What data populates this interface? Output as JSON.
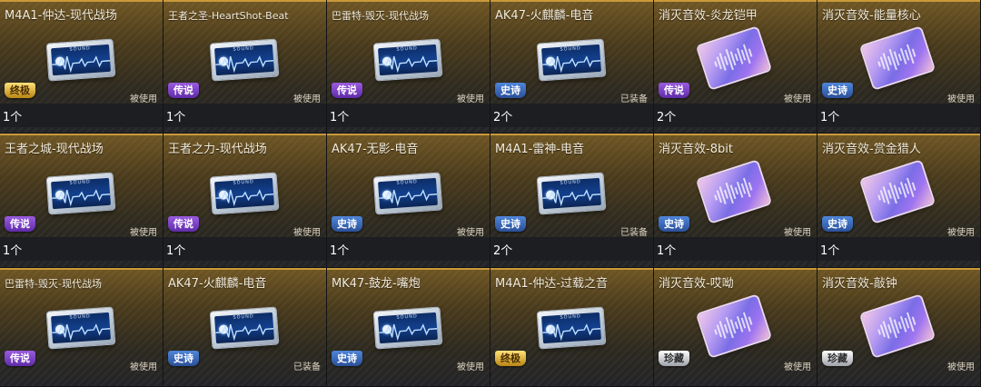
{
  "colors": {
    "card_top": "#6e5523",
    "card_bottom": "#232427",
    "card_border": "#c99a3a",
    "legendary": "#7a3fc8",
    "epic": "#3d6cc0",
    "ultimate": "#e0b030",
    "treasure": "#d9d9d9"
  },
  "items": [
    {
      "title": "M4A1-仲达-现代战场",
      "small": false,
      "type": "silver",
      "badge": "终极",
      "badge_color": "gold",
      "status": "被使用",
      "qty": "1个"
    },
    {
      "title": "王者之圣-HeartShot-Beat",
      "small": true,
      "type": "silver",
      "badge": "传说",
      "badge_color": "purple",
      "status": "被使用",
      "qty": "1个"
    },
    {
      "title": "巴雷特-毁灭-现代战场",
      "small": true,
      "type": "silver",
      "badge": "传说",
      "badge_color": "purple",
      "status": "被使用",
      "qty": "1个"
    },
    {
      "title": "AK47-火麒麟-电音",
      "small": false,
      "type": "silver",
      "badge": "史诗",
      "badge_color": "blue",
      "status": "已装备",
      "qty": "2个"
    },
    {
      "title": "消灭音效-炎龙铠甲",
      "small": false,
      "type": "holo",
      "badge": "传说",
      "badge_color": "purple",
      "status": "被使用",
      "qty": "2个"
    },
    {
      "title": "消灭音效-能量核心",
      "small": false,
      "type": "holo",
      "badge": "史诗",
      "badge_color": "blue",
      "status": "被使用",
      "qty": "1个"
    },
    {
      "title": "王者之城-现代战场",
      "small": false,
      "type": "silver",
      "badge": "传说",
      "badge_color": "purple",
      "status": "被使用",
      "qty": "1个"
    },
    {
      "title": "王者之力-现代战场",
      "small": false,
      "type": "silver",
      "badge": "传说",
      "badge_color": "purple",
      "status": "被使用",
      "qty": "1个"
    },
    {
      "title": "AK47-无影-电音",
      "small": false,
      "type": "silver",
      "badge": "史诗",
      "badge_color": "blue",
      "status": "被使用",
      "qty": "1个"
    },
    {
      "title": "M4A1-雷神-电音",
      "small": false,
      "type": "silver",
      "badge": "史诗",
      "badge_color": "blue",
      "status": "已装备",
      "qty": "2个"
    },
    {
      "title": "消灭音效-8bit",
      "small": false,
      "type": "holo",
      "badge": "史诗",
      "badge_color": "blue",
      "status": "被使用",
      "qty": "1个"
    },
    {
      "title": "消灭音效-赏金猎人",
      "small": false,
      "type": "holo",
      "badge": "史诗",
      "badge_color": "blue",
      "status": "被使用",
      "qty": "1个"
    },
    {
      "title": "巴雷特-毁灭-现代战场",
      "small": true,
      "type": "silver",
      "badge": "传说",
      "badge_color": "purple",
      "status": "被使用",
      "qty": ""
    },
    {
      "title": "AK47-火麒麟-电音",
      "small": false,
      "type": "silver",
      "badge": "史诗",
      "badge_color": "blue",
      "status": "已装备",
      "qty": ""
    },
    {
      "title": "MK47-鼓龙-嘴炮",
      "small": false,
      "type": "silver",
      "badge": "史诗",
      "badge_color": "blue",
      "status": "被使用",
      "qty": ""
    },
    {
      "title": "M4A1-仲达-过载之音",
      "small": false,
      "type": "silver",
      "badge": "终极",
      "badge_color": "gold",
      "status": "",
      "qty": ""
    },
    {
      "title": "消灭音效-哎呦",
      "small": false,
      "type": "holo",
      "badge": "珍藏",
      "badge_color": "silver",
      "status": "被使用",
      "qty": ""
    },
    {
      "title": "消灭音效-敲钟",
      "small": false,
      "type": "holo",
      "badge": "珍藏",
      "badge_color": "silver",
      "status": "被使用",
      "qty": ""
    }
  ],
  "ticket_label": "SOUND",
  "icons": {
    "silver": "sound-ticket-icon",
    "holo": "holo-sound-card-icon"
  }
}
